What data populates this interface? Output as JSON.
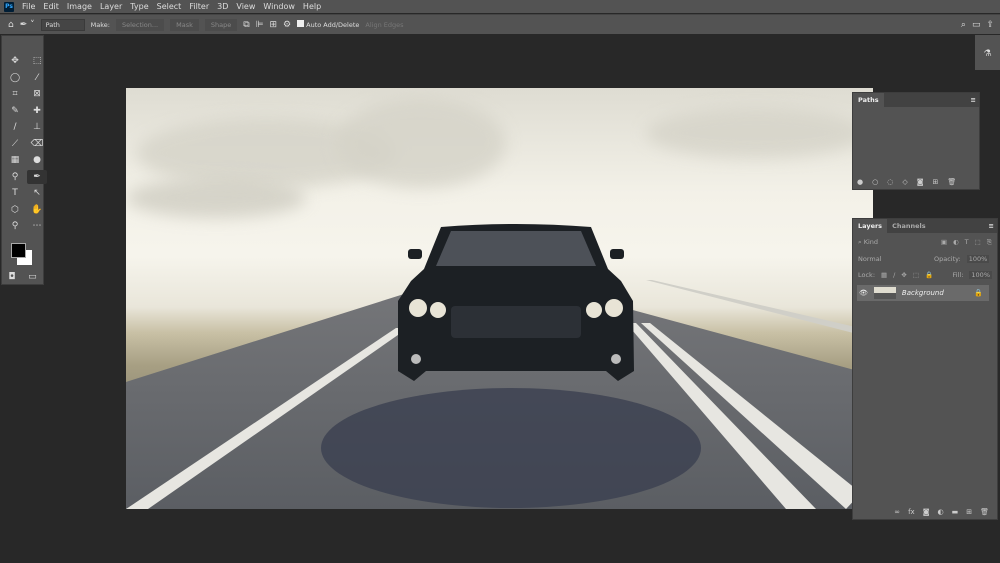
{
  "menu": [
    "File",
    "Edit",
    "Image",
    "Layer",
    "Type",
    "Select",
    "Filter",
    "3D",
    "View",
    "Window",
    "Help"
  ],
  "options": {
    "mode": "Path",
    "make_label": "Make:",
    "selection": "Selection...",
    "mask": "Mask",
    "shape": "Shape",
    "auto_add": "Auto Add/Delete",
    "align_edges": "Align Edges"
  },
  "tools": [
    "✥",
    "⬚",
    "◯",
    "⁄",
    "⌗",
    "⊠",
    "✎",
    "✚",
    "/",
    "⊥",
    "⟋",
    "⌫",
    "▦",
    "●",
    "⚲",
    "✒",
    "T",
    "↖",
    "⬡",
    "✋",
    "⚲",
    "⋯"
  ],
  "paths_panel": {
    "title": "Paths"
  },
  "layers_panel": {
    "tabs": [
      "Layers",
      "Channels"
    ],
    "kind": "Kind",
    "blend": "Normal",
    "opacity_label": "Opacity:",
    "opacity": "100%",
    "lock_label": "Lock:",
    "fill_label": "Fill:",
    "fill": "100%",
    "layer_name": "Background"
  },
  "colors": {
    "foreground": "#000000",
    "background": "#ffffff"
  }
}
